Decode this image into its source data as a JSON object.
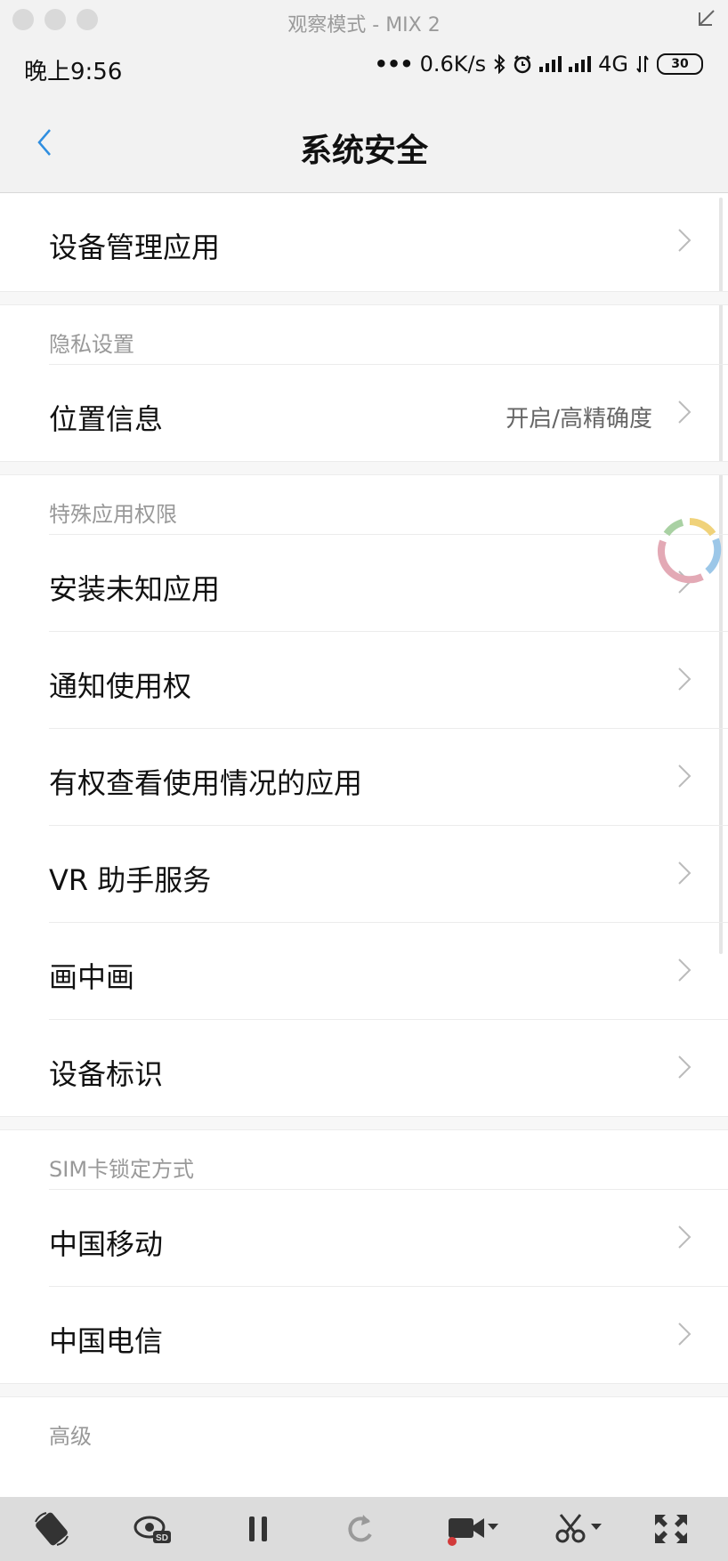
{
  "window": {
    "title": "观察模式 - MIX 2"
  },
  "status_bar": {
    "time": "晚上9:56",
    "speed": "0.6K/s",
    "network": "4G",
    "battery": "30"
  },
  "nav": {
    "title": "系统安全"
  },
  "items": {
    "device_admin": "设备管理应用",
    "privacy_header": "隐私设置",
    "location": {
      "label": "位置信息",
      "value": "开启/高精确度"
    },
    "special_header": "特殊应用权限",
    "install_unknown": "安装未知应用",
    "notification_access": "通知使用权",
    "usage_access": "有权查看使用情况的应用",
    "vr_helper": "VR 助手服务",
    "pip": "画中画",
    "device_id": "设备标识",
    "sim_header": "SIM卡锁定方式",
    "china_mobile": "中国移动",
    "china_telecom": "中国电信",
    "advanced_header": "高级"
  },
  "toolbar": {
    "icons": [
      "rotate-icon",
      "view-sd-icon",
      "pause-icon",
      "refresh-icon",
      "record-video-icon",
      "cut-icon",
      "fullscreen-icon"
    ]
  }
}
